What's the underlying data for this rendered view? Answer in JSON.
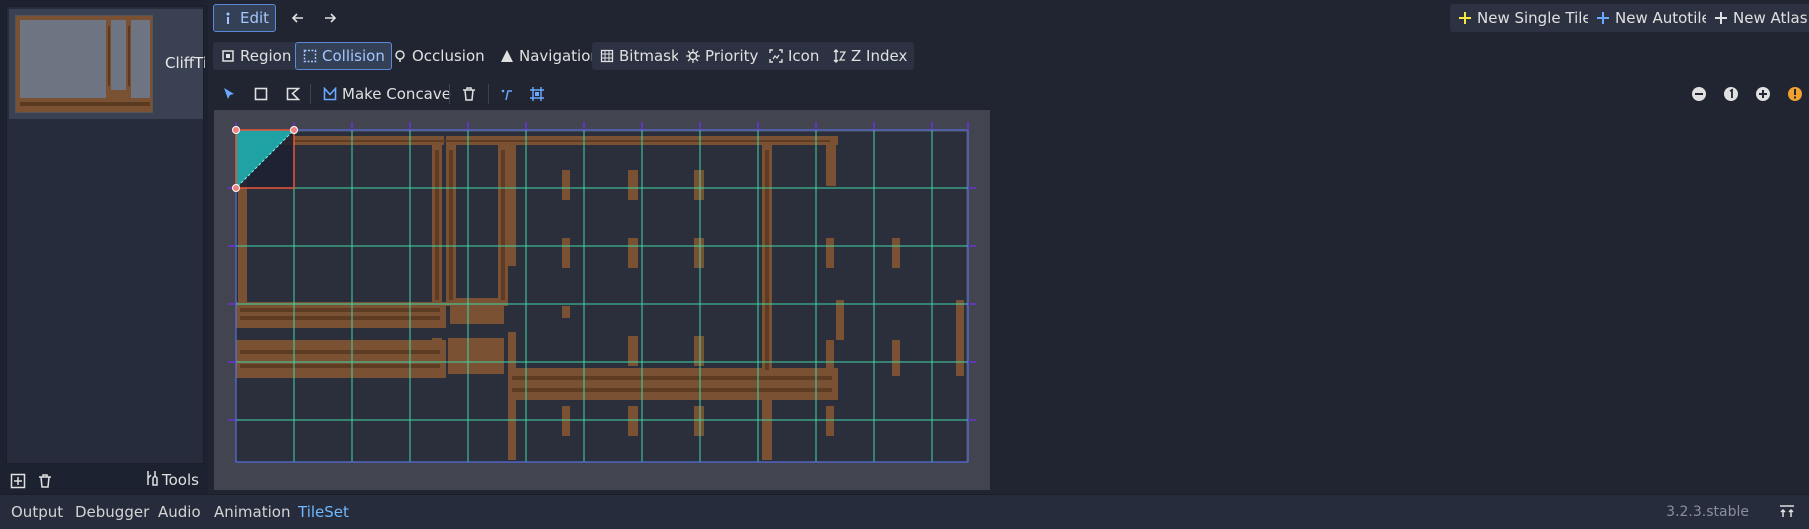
{
  "left_panel": {
    "tile_label": "CliffTiles",
    "tools_label": "Tools"
  },
  "toolbar_top": {
    "edit_label": "Edit",
    "new_single_tile": "New Single Tile",
    "new_autotile": "New Autotile",
    "new_atlas": "New Atlas"
  },
  "mode_tabs": [
    {
      "label": "Region",
      "icon": "region-icon",
      "active": false
    },
    {
      "label": "Collision",
      "icon": "collision-icon",
      "active": true
    },
    {
      "label": "Occlusion",
      "icon": "occlusion-icon",
      "active": false
    },
    {
      "label": "Navigation",
      "icon": "navigation-icon",
      "active": false
    },
    {
      "label": "Bitmask",
      "icon": "bitmask-icon",
      "active": false
    },
    {
      "label": "Priority",
      "icon": "priority-icon",
      "active": false
    },
    {
      "label": "Icon",
      "icon": "icon-icon",
      "active": false
    },
    {
      "label": "Z Index",
      "icon": "z-index-icon",
      "active": false
    }
  ],
  "tool_row": {
    "make_concave": "Make Concave"
  },
  "bottom_tabs": [
    {
      "label": "Output",
      "active": false
    },
    {
      "label": "Debugger",
      "active": false
    },
    {
      "label": "Audio",
      "active": false
    },
    {
      "label": "Animation",
      "active": false
    },
    {
      "label": "TileSet",
      "active": true
    }
  ],
  "version": "3.2.3.stable",
  "colors": {
    "accent": "#70b8ff",
    "grid_outer": "#5a78ff",
    "grid_inner": "#3fd6a6",
    "collision_fill": "#1fb8b8",
    "selection": "#e8563a"
  }
}
